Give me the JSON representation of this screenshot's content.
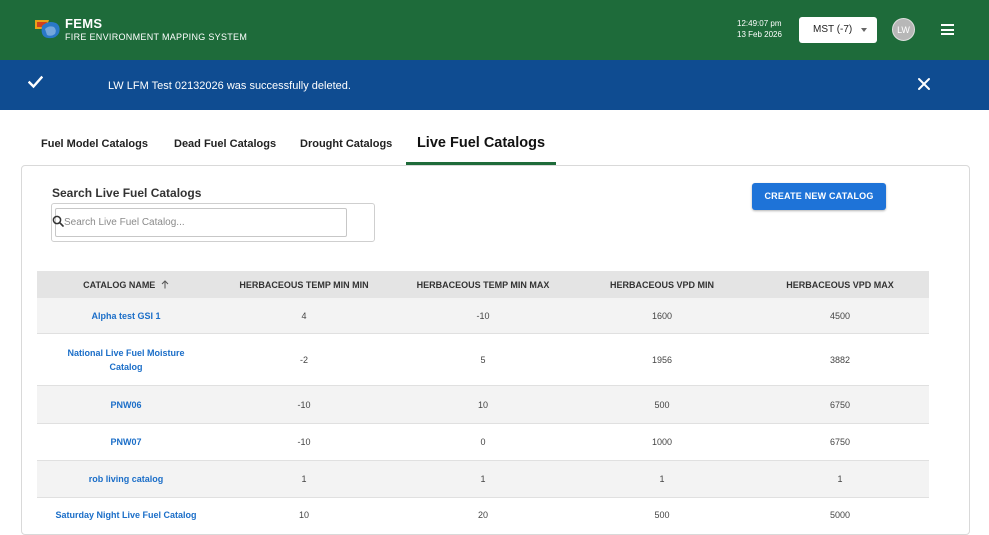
{
  "header": {
    "app_short": "FEMS",
    "app_full": "FIRE ENVIRONMENT MAPPING SYSTEM",
    "time": "12:49:07 pm",
    "date": "13 Feb 2026",
    "timezone": "MST (-7)",
    "user_initials": "LW",
    "brand_color": "#1e6b3a"
  },
  "alert": {
    "message": "LW LFM Test 02132026 was successfully deleted.",
    "color": "#0f4c91"
  },
  "tabs": [
    {
      "label": "Fuel Model Catalogs",
      "active": false
    },
    {
      "label": "Dead Fuel Catalogs",
      "active": false
    },
    {
      "label": "Drought Catalogs",
      "active": false
    },
    {
      "label": "Live Fuel Catalogs",
      "active": true
    }
  ],
  "search": {
    "heading": "Search Live Fuel Catalogs",
    "placeholder": "Search Live Fuel Catalog..."
  },
  "create_button": "CREATE NEW CATALOG",
  "table": {
    "columns": [
      "CATALOG NAME",
      "HERBACEOUS TEMP MIN MIN",
      "HERBACEOUS TEMP MIN MAX",
      "HERBACEOUS VPD MIN",
      "HERBACEOUS VPD MAX"
    ],
    "sort_column": "CATALOG NAME",
    "sort_direction": "ascending",
    "rows": [
      {
        "name": "Alpha test GSI 1",
        "temp_min_min": "4",
        "temp_min_max": "-10",
        "vpd_min": "1600",
        "vpd_max": "4500"
      },
      {
        "name": "National Live Fuel Moisture Catalog",
        "temp_min_min": "-2",
        "temp_min_max": "5",
        "vpd_min": "1956",
        "vpd_max": "3882"
      },
      {
        "name": "PNW06",
        "temp_min_min": "-10",
        "temp_min_max": "10",
        "vpd_min": "500",
        "vpd_max": "6750"
      },
      {
        "name": "PNW07",
        "temp_min_min": "-10",
        "temp_min_max": "0",
        "vpd_min": "1000",
        "vpd_max": "6750"
      },
      {
        "name": "rob living catalog",
        "temp_min_min": "1",
        "temp_min_max": "1",
        "vpd_min": "1",
        "vpd_max": "1"
      },
      {
        "name": "Saturday Night Live Fuel Catalog",
        "temp_min_min": "10",
        "temp_min_max": "20",
        "vpd_min": "500",
        "vpd_max": "5000"
      }
    ]
  }
}
